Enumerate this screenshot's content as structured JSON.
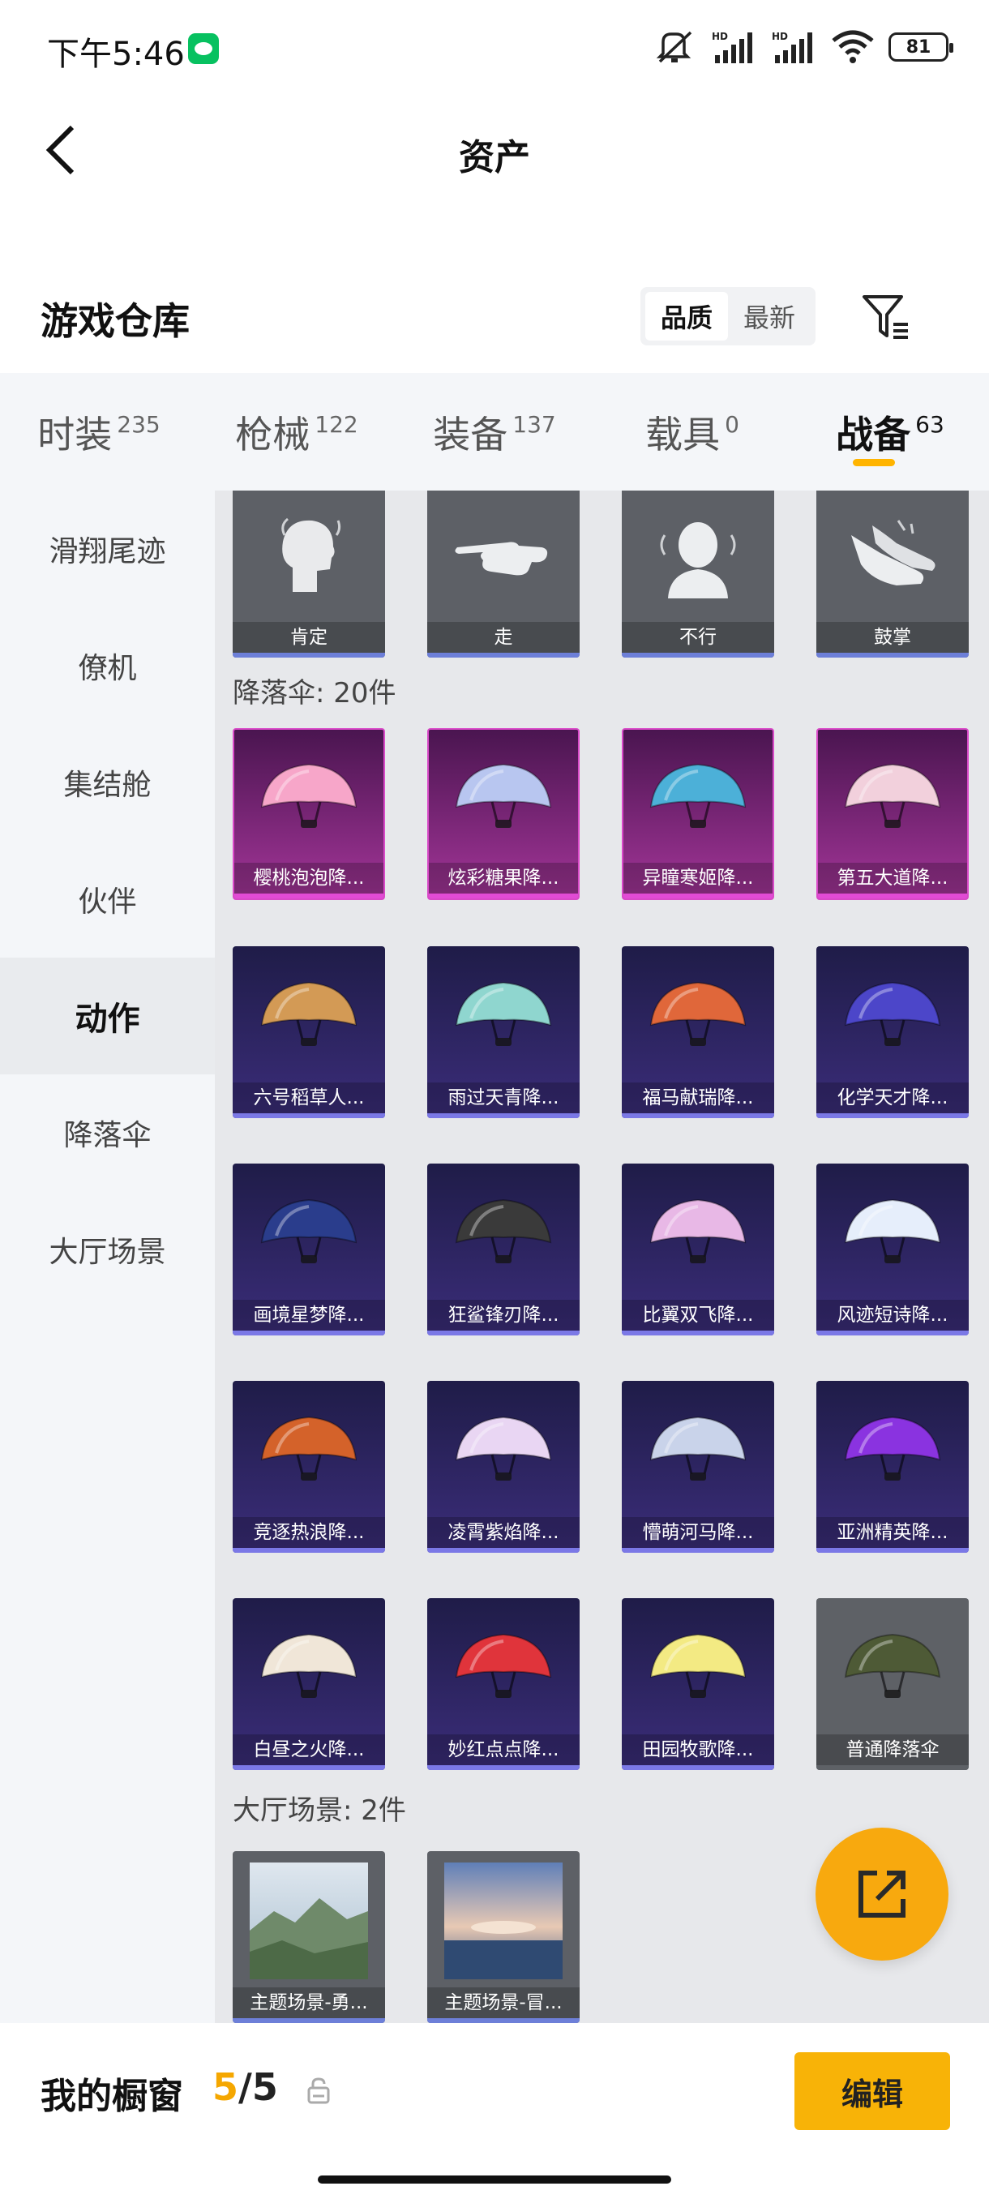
{
  "status_bar": {
    "time": "下午5:46",
    "battery": "81"
  },
  "header": {
    "title": "资产"
  },
  "warehouse": {
    "title": "游戏仓库",
    "sort_options": [
      "品质",
      "最新"
    ],
    "active_sort": "品质"
  },
  "tabs": [
    {
      "label": "时装",
      "count": "235"
    },
    {
      "label": "枪械",
      "count": "122"
    },
    {
      "label": "装备",
      "count": "137"
    },
    {
      "label": "载具",
      "count": "0"
    },
    {
      "label": "战备",
      "count": "63",
      "active": true
    }
  ],
  "sidebar": {
    "items": [
      "滑翔尾迹",
      "僚机",
      "集结舱",
      "伙伴",
      "动作",
      "降落伞",
      "大厅场景"
    ],
    "active": "动作"
  },
  "actions": [
    "肯定",
    "走",
    "不行",
    "鼓掌"
  ],
  "parachutes": {
    "header": "降落伞: 20件",
    "items": [
      "樱桃泡泡降...",
      "炫彩糖果降...",
      "异瞳寒姬降...",
      "第五大道降...",
      "六号稻草人...",
      "雨过天青降...",
      "福马献瑞降...",
      "化学天才降...",
      "画境星梦降...",
      "狂鲨锋刃降...",
      "比翼双飞降...",
      "风迹短诗降...",
      "竞逐热浪降...",
      "凌霄紫焰降...",
      "懵萌河马降...",
      "亚洲精英降...",
      "白昼之火降...",
      "妙红点点降...",
      "田园牧歌降...",
      "普通降落伞"
    ],
    "item_colors": [
      "#f7a6c9",
      "#b8c6f0",
      "#4cb0d8",
      "#f2d0dc",
      "#d39a55",
      "#8fd6cf",
      "#e0673a",
      "#4c46c9",
      "#2a3d8c",
      "#3a3a3a",
      "#e8b8e6",
      "#e6eefb",
      "#d4622a",
      "#e9d6f3",
      "#c9d3ea",
      "#8a33e0",
      "#f0e6d8",
      "#e0343b",
      "#f3ea83",
      "#4e5a36"
    ]
  },
  "lobby": {
    "header": "大厅场景: 2件",
    "items": [
      "主题场景-勇...",
      "主题场景-冒..."
    ]
  },
  "bottom": {
    "title": "我的橱窗",
    "current": "5",
    "total": "/5",
    "edit": "编辑"
  }
}
